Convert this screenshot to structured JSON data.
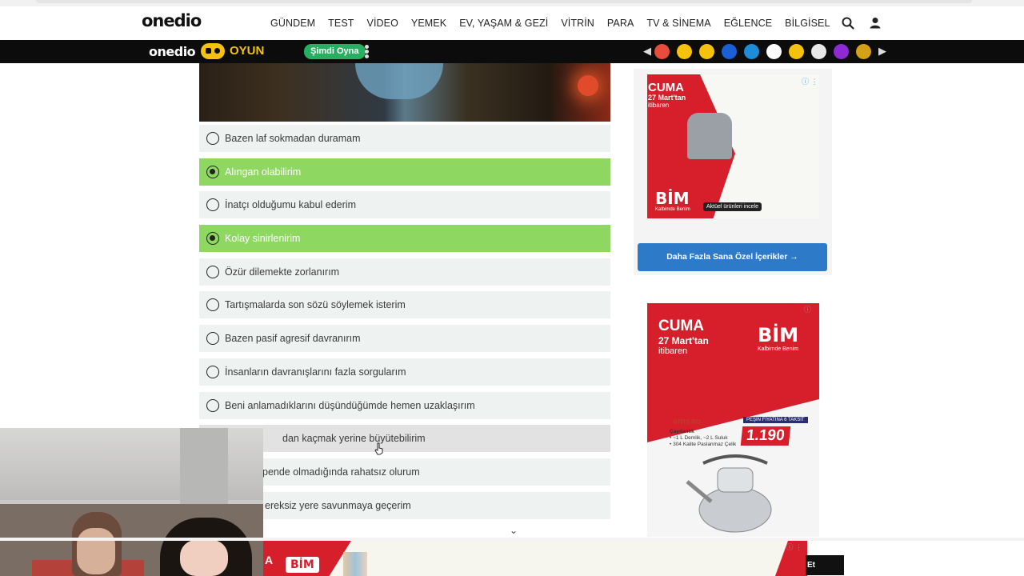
{
  "header": {
    "logo": "onedio",
    "nav": [
      "GÜNDEM",
      "TEST",
      "VİDEO",
      "YEMEK",
      "EV, YAŞAM & GEZİ",
      "VİTRİN",
      "PARA",
      "TV & SİNEMA",
      "EĞLENCE",
      "BİLGİSEL"
    ],
    "icons": [
      "search-icon",
      "user-icon"
    ]
  },
  "gamebar": {
    "logo": "onedio",
    "oyun": "OYUN",
    "play_label": "Şimdi Oyna",
    "game_icons": [
      "#e74c3c",
      "#f4c20d",
      "#f4c20d",
      "#1a5fd6",
      "#1e8cd6",
      "#ffffff",
      "#f4c20d",
      "#ffffff",
      "#8e2ad1",
      "#d4a017"
    ]
  },
  "quiz": {
    "options": [
      {
        "label": "Bazen laf sokmadan duramam",
        "selected": false
      },
      {
        "label": "Alıngan olabilirim",
        "selected": true
      },
      {
        "label": "İnatçı olduğumu kabul ederim",
        "selected": false
      },
      {
        "label": "Kolay sinirlenirim",
        "selected": true
      },
      {
        "label": "Özür dilemekte zorlanırım",
        "selected": false
      },
      {
        "label": "Tartışmalarda son sözü söylemek isterim",
        "selected": false
      },
      {
        "label": "Bazen pasif agresif davranırım",
        "selected": false
      },
      {
        "label": "İnsanların davranışlarını fazla sorgularım",
        "selected": false
      },
      {
        "label": "Beni anlamadıklarını düşündüğümde hemen uzaklaşırım",
        "selected": false
      },
      {
        "label": "dan kaçmak yerine büyütebilirim",
        "selected": false
      },
      {
        "label": "pende olmadığında rahatsız olurum",
        "selected": false
      },
      {
        "label": "ereksiz yere savunmaya geçerim",
        "selected": false
      }
    ]
  },
  "sidebar": {
    "ad1": {
      "headline": "CUMA",
      "date": "27 Mart'tan",
      "sub": "itibaren",
      "brand": "BİM",
      "tagline": "Kalbimde Benim",
      "cta": "Aktüel ürünleri incele"
    },
    "more_button": "Daha Fazla Sana Özel İçerikler",
    "ad2": {
      "headline": "CUMA",
      "date": "27 Mart'tan",
      "sub": "itibaren",
      "brand": "BİM",
      "tagline": "Kalbimde Benim",
      "product_brand": "emsan",
      "tag": "PEŞİN FİYATINA 6 TAKSİT",
      "price": "1.190",
      "specs": [
        "Çaydanlık",
        "• ~1 L Demlik, ~2 L Suluk",
        "• 304 Kalite Paslanmaz Çelik"
      ]
    }
  },
  "bottom_ad": {
    "text": "A",
    "brand": "BİM",
    "button": "Et"
  }
}
